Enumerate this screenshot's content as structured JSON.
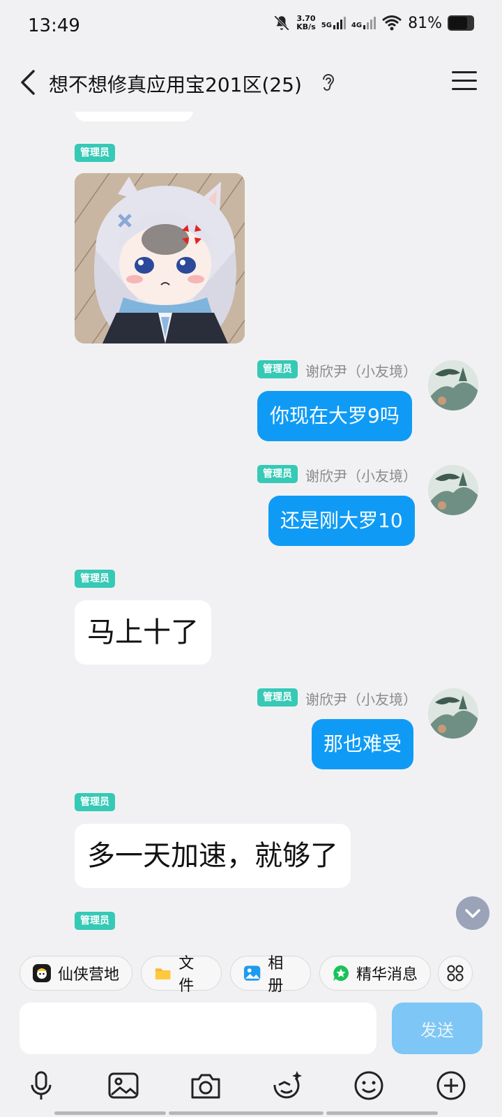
{
  "status_bar": {
    "time": "13:49",
    "speed_value": "3.70",
    "speed_unit": "KB/s",
    "net1": "5G",
    "net2": "4G",
    "battery": "81%"
  },
  "header": {
    "title": "想不想修真应用宝201区(25)"
  },
  "messages": [
    {
      "side": "left",
      "badge": "管理员",
      "type": "sticker"
    },
    {
      "side": "right",
      "badge": "管理员",
      "sender": "谢欣尹（小友境）",
      "text": "你现在大罗9吗"
    },
    {
      "side": "right",
      "badge": "管理员",
      "sender": "谢欣尹（小友境）",
      "text": "还是刚大罗10"
    },
    {
      "side": "left",
      "badge": "管理员",
      "text": "马上十了"
    },
    {
      "side": "right",
      "badge": "管理员",
      "sender": "谢欣尹（小友境）",
      "text": "那也难受"
    },
    {
      "side": "left",
      "badge": "管理员",
      "text": "多一天加速，就够了"
    },
    {
      "side": "left",
      "badge": "管理员",
      "type": "partial"
    }
  ],
  "shortcuts": [
    {
      "label": "仙侠营地",
      "icon": "camp-icon"
    },
    {
      "label": "文件",
      "icon": "folder-icon"
    },
    {
      "label": "相册",
      "icon": "album-icon"
    },
    {
      "label": "精华消息",
      "icon": "star-icon"
    }
  ],
  "input": {
    "placeholder": "",
    "send_label": "发送"
  },
  "toolbar": [
    "mic-icon",
    "image-icon",
    "camera-icon",
    "emoji-sticker-icon",
    "smile-icon",
    "plus-icon"
  ],
  "colors": {
    "background": "#f1f1f3",
    "accent": "#0f9bf5",
    "badge": "#36c9b6",
    "send_disabled": "#7ec6f5"
  }
}
